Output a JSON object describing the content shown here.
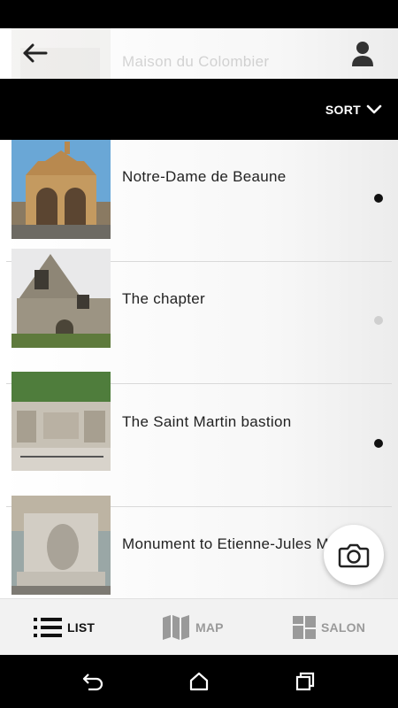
{
  "header": {
    "partial_item_title": "Maison du Colombier"
  },
  "sort": {
    "label": "SORT"
  },
  "list": {
    "items": [
      {
        "title": "Notre-Dame de Beaune",
        "visited": true
      },
      {
        "title": "The chapter",
        "visited": false
      },
      {
        "title": "The Saint Martin bastion",
        "visited": true
      },
      {
        "title": "Monument to Etienne-Jules Marey",
        "visited": false
      }
    ]
  },
  "tabs": [
    {
      "label": "LIST",
      "icon": "list-icon",
      "active": true
    },
    {
      "label": "MAP",
      "icon": "map-icon",
      "active": false
    },
    {
      "label": "SALON",
      "icon": "grid-icon",
      "active": false
    }
  ],
  "colors": {
    "black": "#000000",
    "visited_dot": "#111111",
    "unvisited_dot": "#cfcfcf",
    "inactive_tab": "#9a9a9a"
  }
}
